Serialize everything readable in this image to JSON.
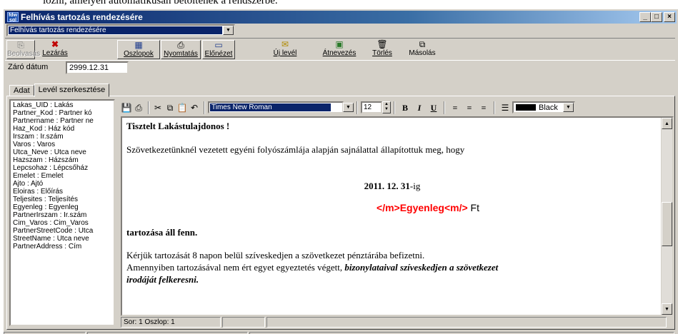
{
  "background_text": "iozni, amelyen automatikusan betoltenek a rendszerbe.",
  "window": {
    "title": "Felhívás tartozás rendezésére",
    "icon_text": "fdw sql",
    "minimize": "_",
    "maximize": "□",
    "close": "×"
  },
  "template_select": {
    "value": "Felhívás tartozás rendezésére"
  },
  "toolbar": {
    "beolvasas": "Beolvasás",
    "lezaras": "Lezárás",
    "oszlopok": "Oszlopok",
    "nyomtatas": "Nyomtatás",
    "elonezet": "Előnézet",
    "uj_level": "Új levél",
    "atnevezes": "Átnevezés",
    "torles": "Törlés",
    "masolas": "Másolás"
  },
  "closing_date": {
    "label": "Záró dátum",
    "value": "2999.12.31"
  },
  "tabs": {
    "adat": "Adat",
    "level": "Levél szerkesztése"
  },
  "fields": [
    "Lakas_UID : Lakás",
    "Partner_Kod : Partner kó",
    "Partnername : Partner ne",
    "Haz_Kod : Ház kód",
    "Irszam : Ir.szám",
    "Varos : Varos",
    "Utca_Neve : Utca neve",
    "Hazszam : Házszám",
    "Lepcsohaz : Lépcsőház",
    "Emelet : Emelet",
    "Ajto : Ajtó",
    "Eloiras : Előírás",
    "Teljesites : Teljesítés",
    "Egyenleg : Egyenleg",
    "PartnerIrszam : Ir.szám",
    "Cim_Varos : Cim_Varos",
    "PartnerStreetCode : Utca",
    "StreetName : Utca neve",
    "PartnerAddress : Cím"
  ],
  "editor_toolbar": {
    "font": "Times New Roman",
    "size": "12",
    "bold": "B",
    "italic": "I",
    "underline": "U",
    "color_label": "Black",
    "color_hex": "#000000"
  },
  "letter": {
    "greeting": "Tisztelt Lakástulajdonos !",
    "line1": "Szövetkezetünknél vezetett egyéni folyószámlája alapján sajnálattal állapítottuk meg, hogy",
    "date_bold": "2011. 12. 31",
    "date_suffix": "-ig",
    "amount_field": "</m>Egyenleg<m/>",
    "amount_unit": " Ft",
    "debt": "tartozása áll fenn.",
    "line2": "Kérjük tartozását 8 napon belül szíveskedjen a szövetkezet pénztárába befizetni.",
    "line3_plain": "Amennyiben tartozásával nem ért egyet egyeztetés végett, ",
    "line3_bold_italic": "bizonylataival  szíveskedjen a szövetkezet",
    "line4_bold_italic": "irodáját felkeresni.",
    "field_color": "#ff0000"
  },
  "editor_status": {
    "row_col": "Sor:  1  Oszlop:  1"
  }
}
